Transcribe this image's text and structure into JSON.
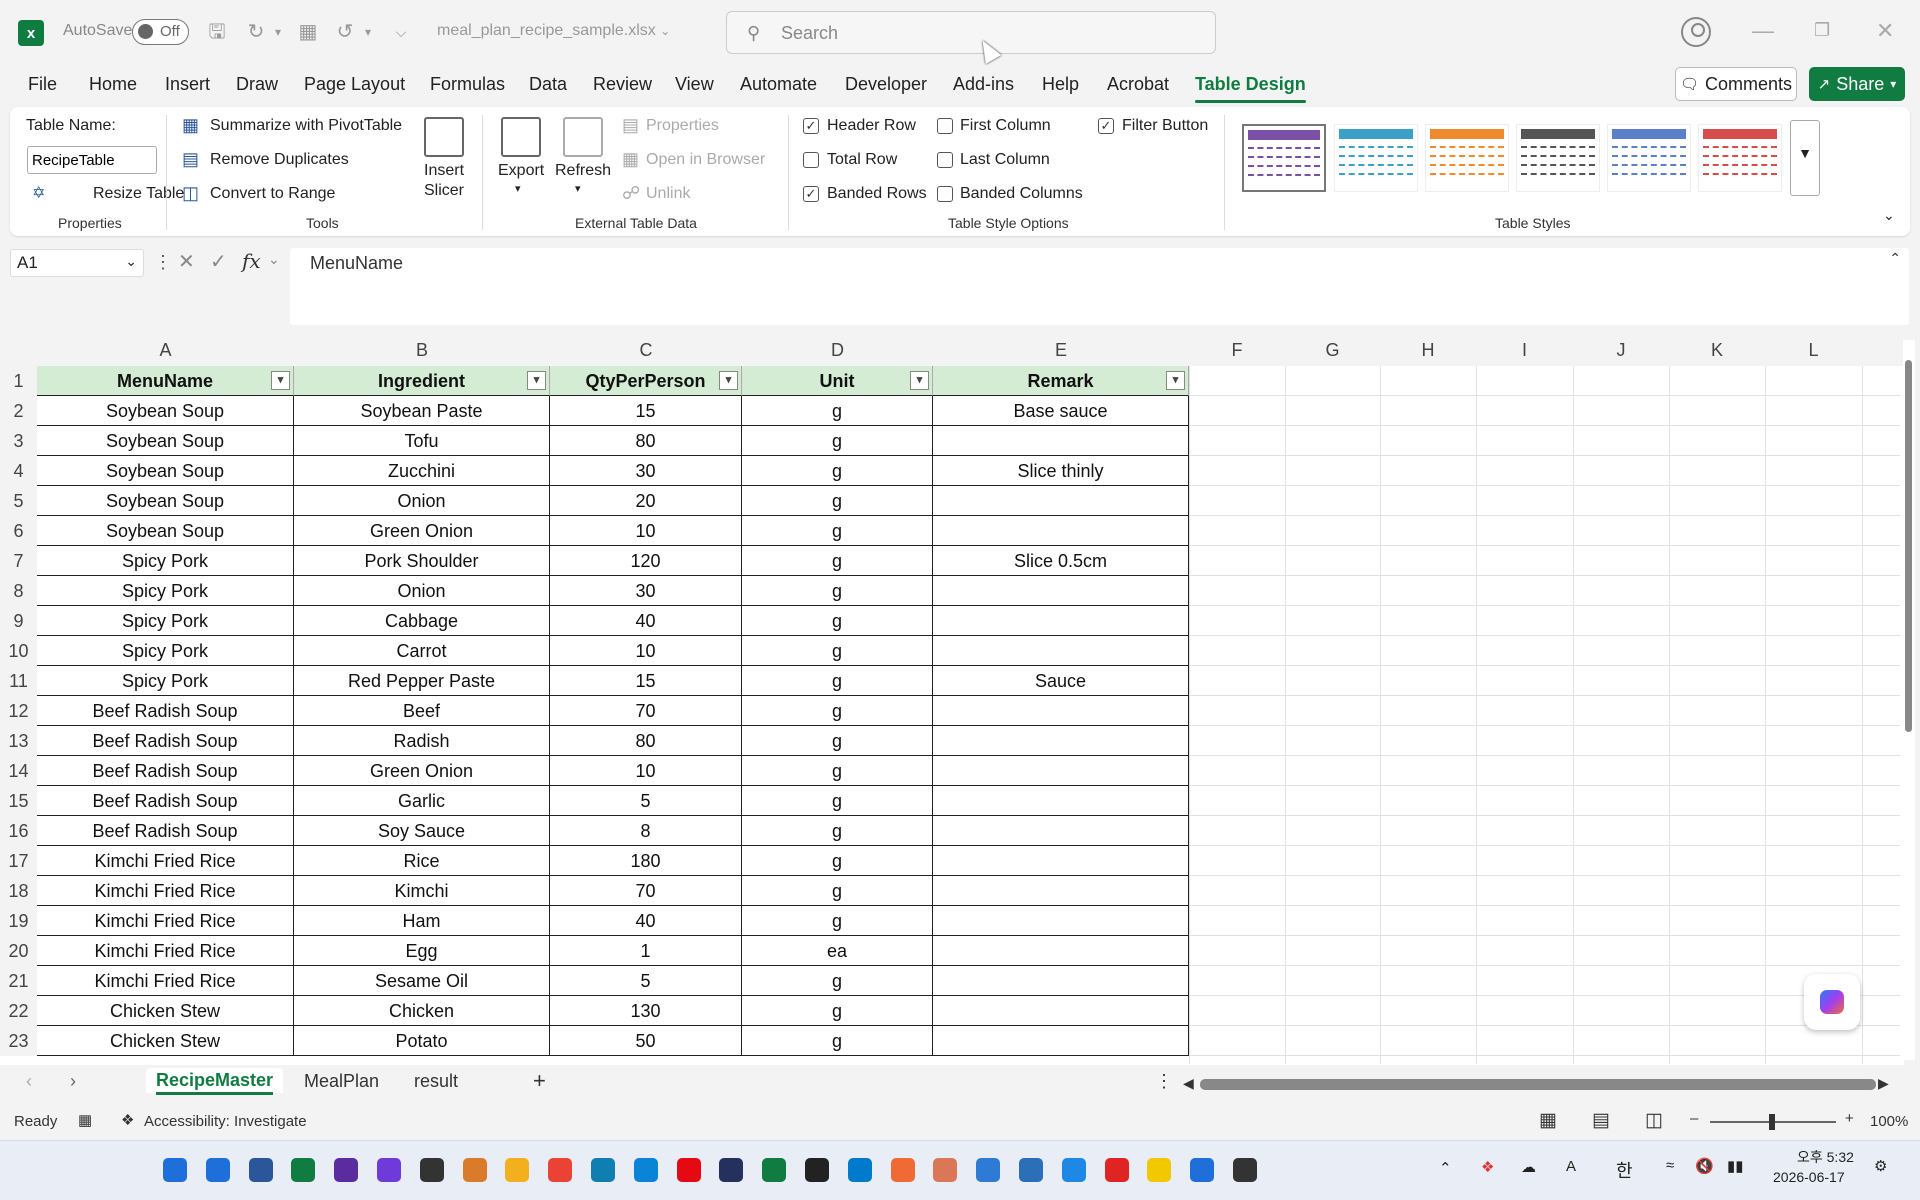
{
  "titlebar": {
    "autosave_label": "AutoSave",
    "autosave_state": "Off",
    "file_name": "meal_plan_recipe_sample.xlsx",
    "search_placeholder": "Search"
  },
  "menu": {
    "items": [
      "File",
      "Home",
      "Insert",
      "Draw",
      "Page Layout",
      "Formulas",
      "Data",
      "Review",
      "View",
      "Automate",
      "Developer",
      "Add-ins",
      "Help",
      "Acrobat",
      "Table Design"
    ],
    "active": "Table Design",
    "comments_label": "Comments",
    "share_label": "Share"
  },
  "ribbon": {
    "properties": {
      "table_name_label": "Table Name:",
      "table_name_value": "RecipeTable",
      "resize_label": "Resize Table",
      "group_label": "Properties"
    },
    "tools": {
      "pivot_label": "Summarize with PivotTable",
      "dup_label": "Remove Duplicates",
      "convert_label": "Convert to Range",
      "slicer_label_1": "Insert",
      "slicer_label_2": "Slicer",
      "group_label": "Tools"
    },
    "external": {
      "export_label": "Export",
      "refresh_label": "Refresh",
      "properties_label": "Properties",
      "browser_label": "Open in Browser",
      "unlink_label": "Unlink",
      "group_label": "External Table Data"
    },
    "style_options": {
      "header_row": "Header Row",
      "total_row": "Total Row",
      "banded_rows": "Banded Rows",
      "first_column": "First Column",
      "last_column": "Last Column",
      "banded_columns": "Banded Columns",
      "filter_button": "Filter Button",
      "group_label": "Table Style Options"
    },
    "styles": {
      "group_label": "Table Styles",
      "swatch_colors": [
        "#7b4fa5",
        "#3aa0c8",
        "#ef8a2d",
        "#555555",
        "#5b7fc8",
        "#d94c4c"
      ]
    }
  },
  "formula_bar": {
    "cell_ref": "A1",
    "content": "MenuName"
  },
  "columns": [
    "A",
    "B",
    "C",
    "D",
    "E",
    "F",
    "G",
    "H",
    "I",
    "J",
    "K",
    "L"
  ],
  "table": {
    "headers": [
      "MenuName",
      "Ingredient",
      "QtyPerPerson",
      "Unit",
      "Remark"
    ],
    "rows": [
      [
        "Soybean Soup",
        "Soybean Paste",
        "15",
        "g",
        "Base sauce"
      ],
      [
        "Soybean Soup",
        "Tofu",
        "80",
        "g",
        ""
      ],
      [
        "Soybean Soup",
        "Zucchini",
        "30",
        "g",
        "Slice thinly"
      ],
      [
        "Soybean Soup",
        "Onion",
        "20",
        "g",
        ""
      ],
      [
        "Soybean Soup",
        "Green Onion",
        "10",
        "g",
        ""
      ],
      [
        "Spicy Pork",
        "Pork Shoulder",
        "120",
        "g",
        "Slice 0.5cm"
      ],
      [
        "Spicy Pork",
        "Onion",
        "30",
        "g",
        ""
      ],
      [
        "Spicy Pork",
        "Cabbage",
        "40",
        "g",
        ""
      ],
      [
        "Spicy Pork",
        "Carrot",
        "10",
        "g",
        ""
      ],
      [
        "Spicy Pork",
        "Red Pepper Paste",
        "15",
        "g",
        "Sauce"
      ],
      [
        "Beef Radish Soup",
        "Beef",
        "70",
        "g",
        ""
      ],
      [
        "Beef Radish Soup",
        "Radish",
        "80",
        "g",
        ""
      ],
      [
        "Beef Radish Soup",
        "Green Onion",
        "10",
        "g",
        ""
      ],
      [
        "Beef Radish Soup",
        "Garlic",
        "5",
        "g",
        ""
      ],
      [
        "Beef Radish Soup",
        "Soy Sauce",
        "8",
        "g",
        ""
      ],
      [
        "Kimchi Fried Rice",
        "Rice",
        "180",
        "g",
        ""
      ],
      [
        "Kimchi Fried Rice",
        "Kimchi",
        "70",
        "g",
        ""
      ],
      [
        "Kimchi Fried Rice",
        "Ham",
        "40",
        "g",
        ""
      ],
      [
        "Kimchi Fried Rice",
        "Egg",
        "1",
        "ea",
        ""
      ],
      [
        "Kimchi Fried Rice",
        "Sesame Oil",
        "5",
        "g",
        ""
      ],
      [
        "Chicken Stew",
        "Chicken",
        "130",
        "g",
        ""
      ],
      [
        "Chicken Stew",
        "Potato",
        "50",
        "g",
        ""
      ]
    ]
  },
  "sheets": [
    "RecipeMaster",
    "MealPlan",
    "result"
  ],
  "active_sheet": "RecipeMaster",
  "status": {
    "ready": "Ready",
    "accessibility": "Accessibility: Investigate",
    "zoom": "100%"
  },
  "taskbar": {
    "time": "오후 5:32",
    "date": "2026-06-17",
    "ime": "한",
    "icon_colors": [
      "#1e6fd9",
      "#1e6fd9",
      "#2b579a",
      "#107c41",
      "#5a2ca0",
      "#6e3ad9",
      "#333333",
      "#d97b2a",
      "#f2b01e",
      "#ea4335",
      "#0e7fb0",
      "#0a84d6",
      "#e50914",
      "#24305e",
      "#107c41",
      "#222222",
      "#007acc",
      "#f06a35",
      "#d97757",
      "#2e7bd6",
      "#2b6fb6",
      "#1e88e5",
      "#e02424",
      "#f2c900",
      "#1e6fd9",
      "#333333"
    ]
  }
}
